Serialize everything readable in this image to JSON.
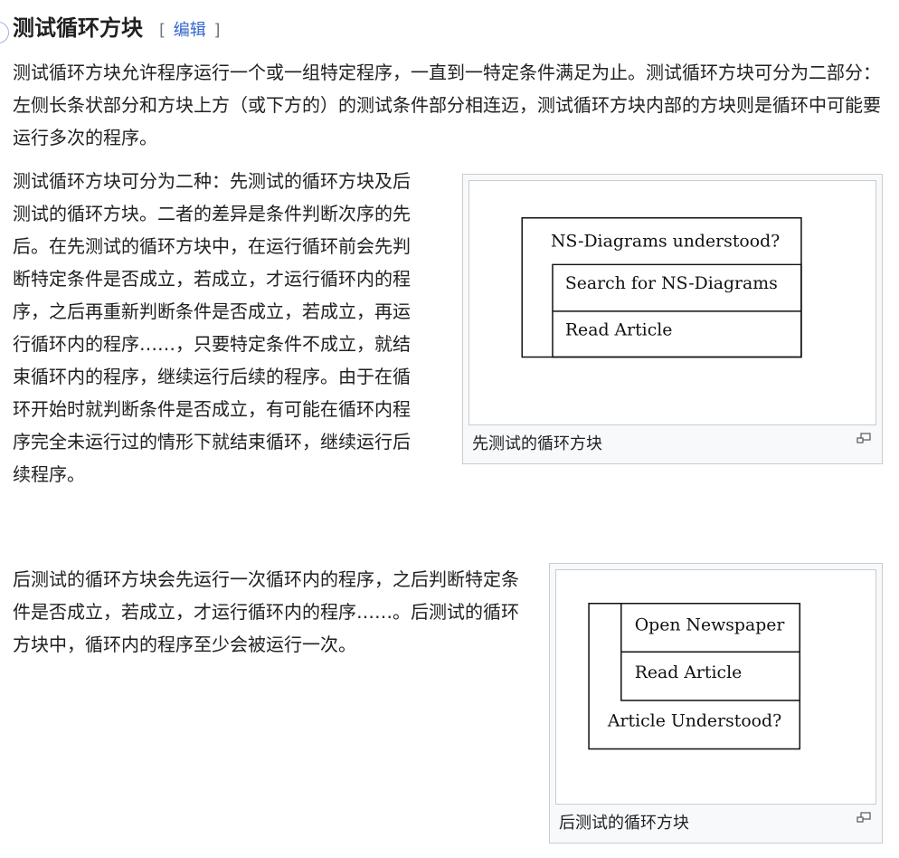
{
  "section": {
    "title": "测试循环方块",
    "edit_open": "[",
    "edit_label": "编辑",
    "edit_close": "]"
  },
  "paragraphs": {
    "intro": "测试循环方块允许程序运行一个或一组特定程序，一直到一特定条件满足为止。测试循环方块可分为二部分：左侧长条状部分和方块上方（或下方的）的测试条件部分相连迈，测试循环方块内部的方块则是循环中可能要运行多次的程序。",
    "pretest": "测试循环方块可分为二种：先测试的循环方块及后测试的循环方块。二者的差异是条件判断次序的先后。在先测试的循环方块中，在运行循环前会先判断特定条件是否成立，若成立，才运行循环内的程序，之后再重新判断条件是否成立，若成立，再运行循环内的程序……，只要特定条件不成立，就结束循环内的程序，继续运行后续的程序。由于在循环开始时就判断条件是否成立，有可能在循环内程序完全未运行过的情形下就结束循环，继续运行后续程序。",
    "posttest": "后测试的循环方块会先运行一次循环内的程序，之后判断特定条件是否成立，若成立，才运行循环内的程序……。后测试的循环方块中，循环内的程序至少会被运行一次。"
  },
  "figures": {
    "pretest": {
      "caption": "先测试的循环方块",
      "condition": "NS-Diagrams understood?",
      "steps": [
        "Search for NS-Diagrams",
        "Read Article"
      ]
    },
    "posttest": {
      "caption": "后测试的循环方块",
      "steps": [
        "Open Newspaper",
        "Read Article"
      ],
      "condition": "Article Understood?"
    }
  },
  "icons": {
    "magnify": "magnify-icon"
  },
  "colors": {
    "link": "#3366cc",
    "text": "#202122",
    "thumb_border": "#c8ccd1",
    "thumb_bg": "#f8f9fa"
  }
}
